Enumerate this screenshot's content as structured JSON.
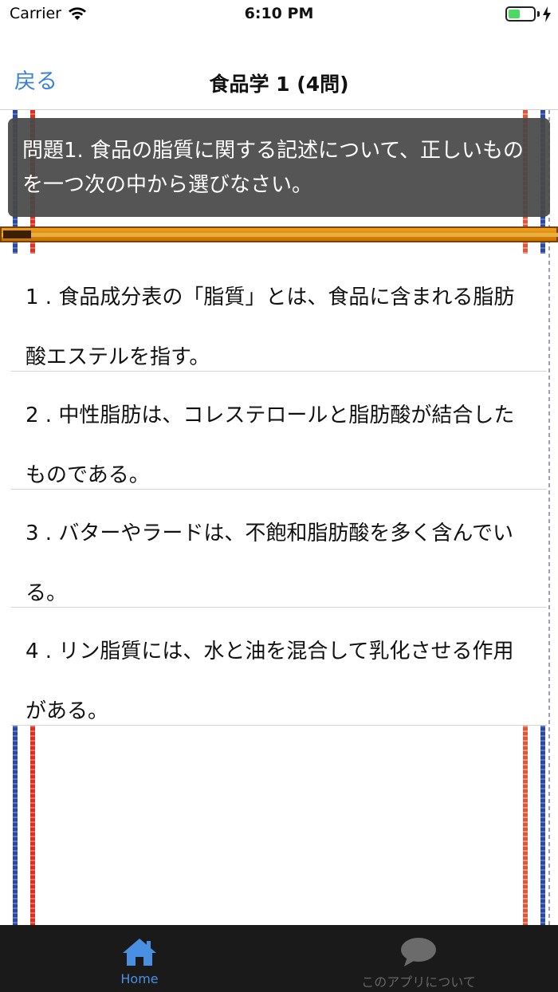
{
  "status_bar": {
    "carrier": "Carrier",
    "time": "6:10 PM",
    "battery_level": 0.45
  },
  "nav": {
    "back_label": "戻る",
    "title": "食品学 1 (4問)"
  },
  "question": {
    "text": "問題1. 食品の脂質に関する記述について、正しいものを一つ次の中から選びなさい。"
  },
  "progress": {
    "value": 0.05
  },
  "answers": [
    {
      "text": "1 . 食品成分表の「脂質」とは、食品に含まれる脂肪酸エステルを指す。"
    },
    {
      "text": "2 . 中性脂肪は、コレステロールと脂肪酸が結合したものである。"
    },
    {
      "text": "3 . バターやラードは、不飽和脂肪酸を多く含んでいる。"
    },
    {
      "text": "4 . リン脂質には、水と油を混合して乳化させる作用がある。"
    }
  ],
  "tab_bar": {
    "tabs": [
      {
        "label": "Home",
        "icon": "home-icon",
        "active": true
      },
      {
        "label": "このアプリについて",
        "icon": "speech-bubble-icon",
        "active": false
      }
    ]
  },
  "colors": {
    "accent": "#4a90e2",
    "back_link": "#3b82d6",
    "question_bg": "#484848",
    "tab_bar_bg": "#1a1a1a",
    "progress": "#e8a020"
  }
}
